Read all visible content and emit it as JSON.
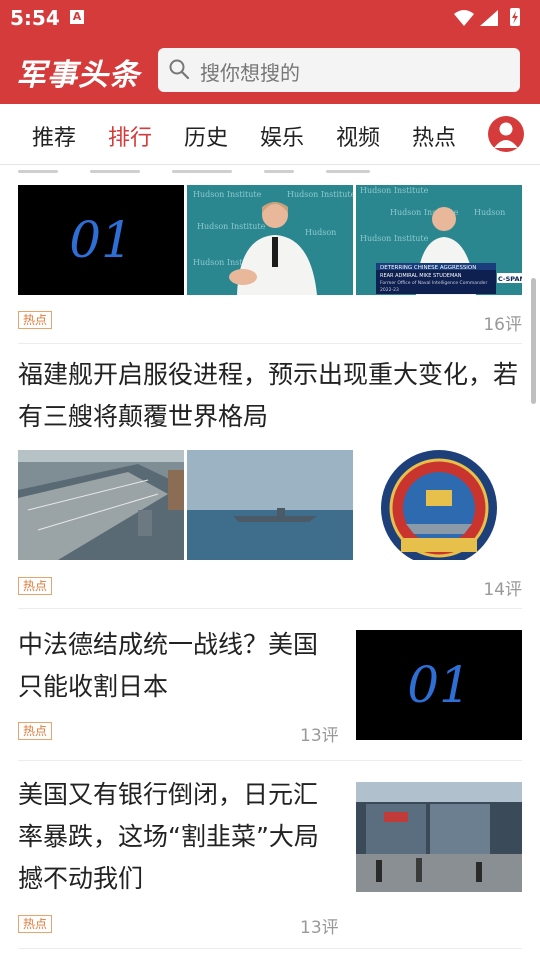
{
  "status": {
    "time": "5:54",
    "notification_icon": "A"
  },
  "header": {
    "brand": "军事头条",
    "search_placeholder": "搜你想搜的"
  },
  "tabs": [
    {
      "label": "推荐"
    },
    {
      "label": "排行",
      "active": true
    },
    {
      "label": "历史"
    },
    {
      "label": "娱乐"
    },
    {
      "label": "视频"
    },
    {
      "label": "热点"
    }
  ],
  "articles": [
    {
      "title": "",
      "images": [
        "01",
        "hudson-institute-interview",
        "hudson-institute-interview-caption"
      ],
      "caption_texts": {
        "hudson": "Hudson Institute",
        "caption1": "DETERRING CHINESE AGGRESSION",
        "caption2": "REAR ADMIRAL MIKE STUDEMAN",
        "caption3": "Former Office of Naval Intelligence Commander",
        "caption4": "2022-23",
        "cspan": "C-SPAN"
      },
      "tag": "热点",
      "comments": "16评"
    },
    {
      "title": "福建舰开启服役进程，预示出现重大变化，若有三艘将颠覆世界格局",
      "images": [
        "carrier-deck",
        "carrier-sea",
        "navy-emblem"
      ],
      "tag": "热点",
      "comments": "14评"
    },
    {
      "title": "中法德结成统一战线？美国只能收割日本",
      "images": [
        "01"
      ],
      "tag": "热点",
      "comments": "13评"
    },
    {
      "title": "美国又有银行倒闭，日元汇率暴跌，这场“割韭菜”大局撼不动我们",
      "images": [
        "bank-street"
      ],
      "tag": "热点",
      "comments": "13评"
    }
  ],
  "colors": {
    "brand_red": "#d63b3b",
    "tag_orange": "#e07b3a",
    "muted": "#999999"
  }
}
